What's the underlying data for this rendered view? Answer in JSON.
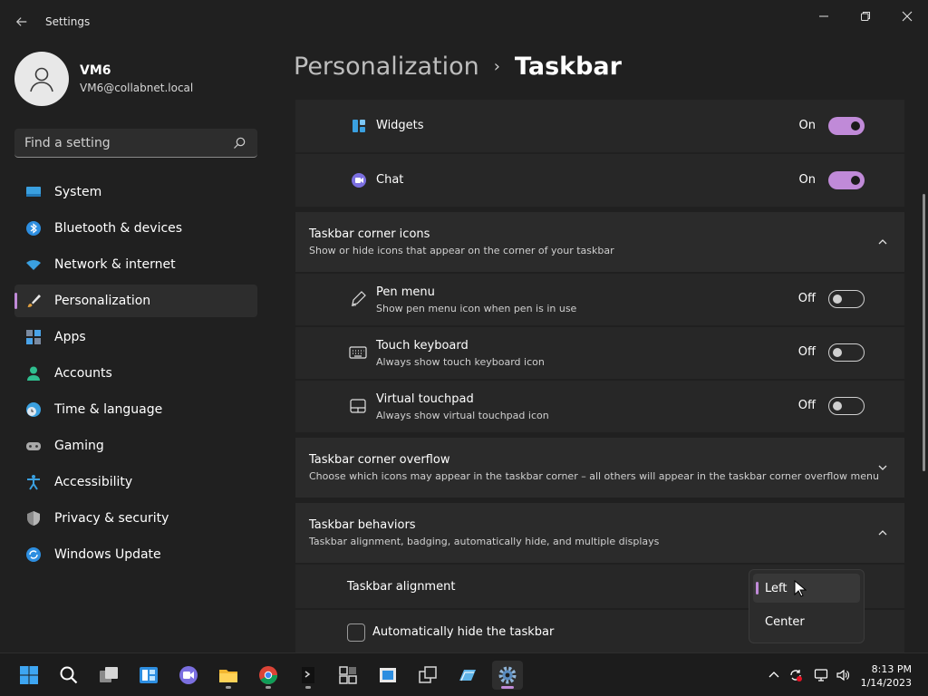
{
  "window": {
    "title": "Settings",
    "back_icon": "back-arrow-icon",
    "controls": [
      "minimize-icon",
      "restore-icon",
      "close-icon"
    ]
  },
  "profile": {
    "name": "VM6",
    "email": "VM6@collabnet.local"
  },
  "search": {
    "placeholder": "Find a setting"
  },
  "sidebar": {
    "items": [
      {
        "label": "System",
        "icon": "monitor-icon",
        "active": false
      },
      {
        "label": "Bluetooth & devices",
        "icon": "bluetooth-icon",
        "active": false
      },
      {
        "label": "Network & internet",
        "icon": "wifi-icon",
        "active": false
      },
      {
        "label": "Personalization",
        "icon": "brush-icon",
        "active": true
      },
      {
        "label": "Apps",
        "icon": "apps-icon",
        "active": false
      },
      {
        "label": "Accounts",
        "icon": "person-icon",
        "active": false
      },
      {
        "label": "Time & language",
        "icon": "globe-clock-icon",
        "active": false
      },
      {
        "label": "Gaming",
        "icon": "gamepad-icon",
        "active": false
      },
      {
        "label": "Accessibility",
        "icon": "accessibility-icon",
        "active": false
      },
      {
        "label": "Privacy & security",
        "icon": "shield-icon",
        "active": false
      },
      {
        "label": "Windows Update",
        "icon": "update-icon",
        "active": false
      }
    ]
  },
  "breadcrumb": {
    "parent": "Personalization",
    "separator": "›",
    "current": "Taskbar"
  },
  "taskbar_items_section": {
    "widgets": {
      "label": "Widgets",
      "state": "On",
      "on": true
    },
    "chat": {
      "label": "Chat",
      "state": "On",
      "on": true
    }
  },
  "corner_icons": {
    "title": "Taskbar corner icons",
    "desc": "Show or hide icons that appear on the corner of your taskbar",
    "expanded": true,
    "rows": {
      "pen": {
        "label": "Pen menu",
        "desc": "Show pen menu icon when pen is in use",
        "state": "Off",
        "on": false
      },
      "touch_keyboard": {
        "label": "Touch keyboard",
        "desc": "Always show touch keyboard icon",
        "state": "Off",
        "on": false
      },
      "virtual_touchpad": {
        "label": "Virtual touchpad",
        "desc": "Always show virtual touchpad icon",
        "state": "Off",
        "on": false
      }
    }
  },
  "corner_overflow": {
    "title": "Taskbar corner overflow",
    "desc": "Choose which icons may appear in the taskbar corner – all others will appear in the taskbar corner overflow menu",
    "expanded": false
  },
  "behaviors": {
    "title": "Taskbar behaviors",
    "desc": "Taskbar alignment, badging, automatically hide, and multiple displays",
    "expanded": true,
    "alignment_label": "Taskbar alignment",
    "auto_hide_label": "Automatically hide the taskbar"
  },
  "alignment_dropdown": {
    "options": [
      "Left",
      "Center"
    ],
    "selected": "Left"
  },
  "taskbar": {
    "apps": [
      "windows-start-icon",
      "search-icon",
      "task-view-icon",
      "widgets-icon",
      "teams-chat-icon",
      "file-explorer-icon",
      "chrome-icon",
      "terminal-icon",
      "remote-desktop-icon",
      "store-icon",
      "network-window-icon",
      "edge-icon",
      "settings-gear-icon"
    ],
    "tray": [
      "chevron-up-icon",
      "sync-icon",
      "network-icon",
      "volume-icon"
    ],
    "time": "8:13 PM",
    "date": "1/14/2023"
  },
  "colors": {
    "accent": "#c08ad8",
    "background": "#202020",
    "card": "#2b2b2b"
  }
}
